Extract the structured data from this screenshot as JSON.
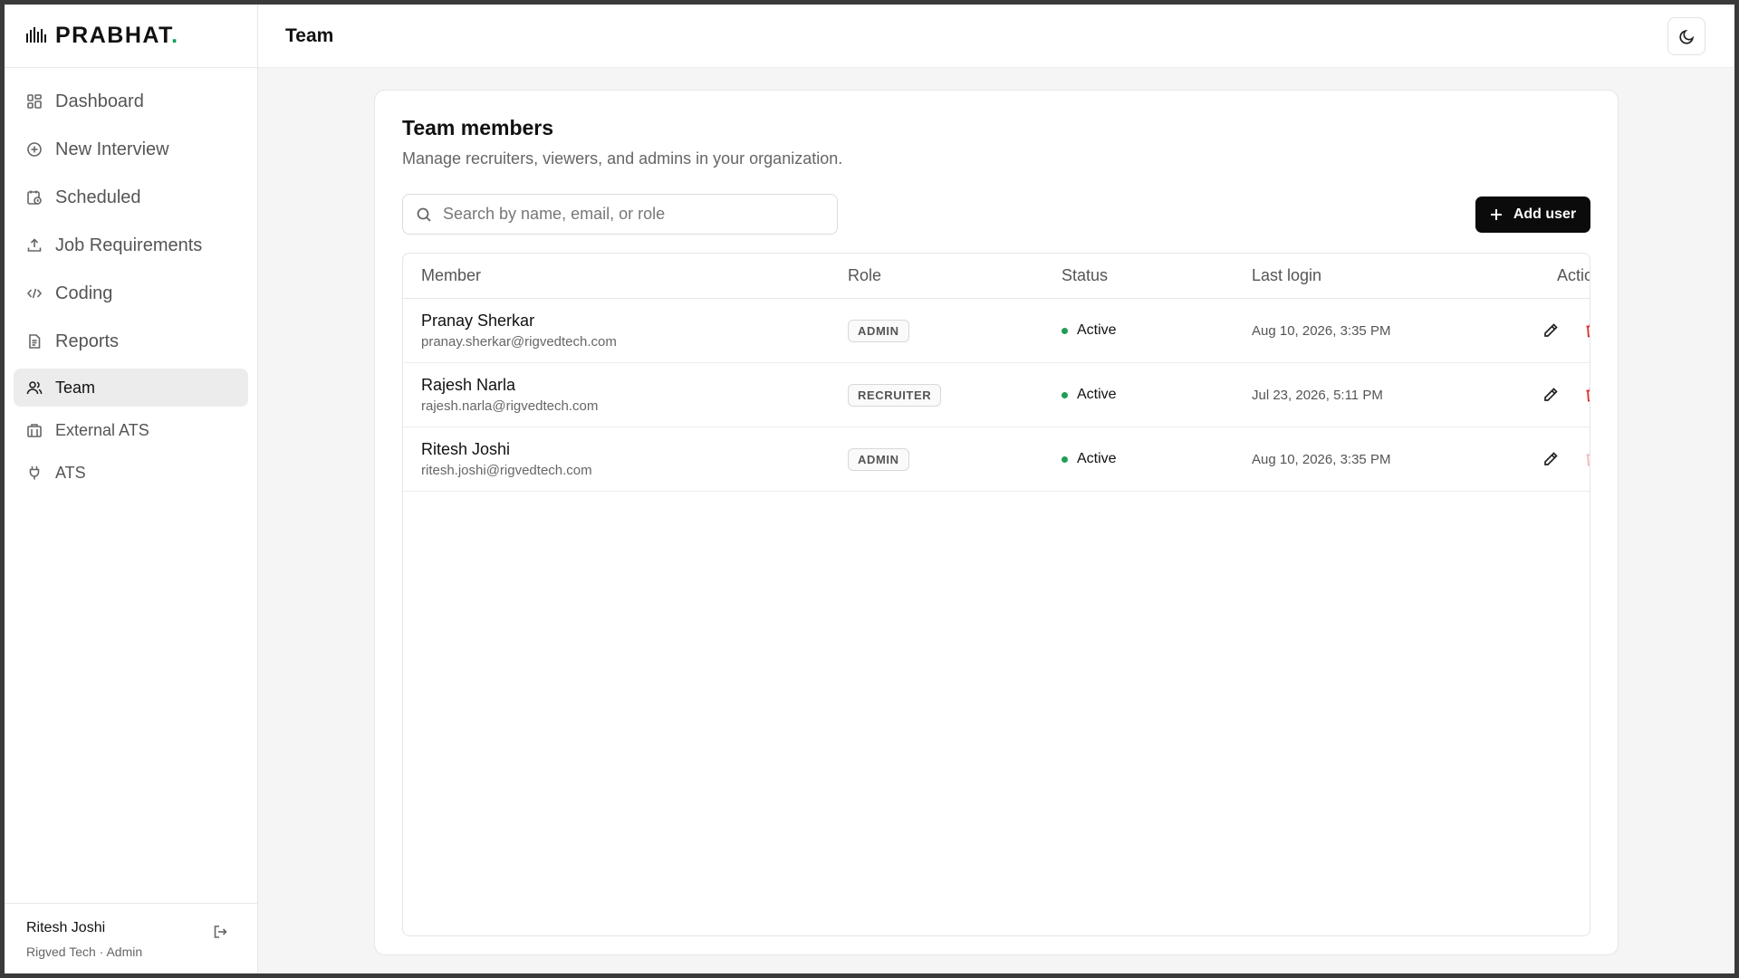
{
  "brand": {
    "name": "PRABHAT",
    "dot": ".",
    "accent": "#0f9d58"
  },
  "sidebar": {
    "items": [
      {
        "label": "Dashboard",
        "icon": "grid-icon"
      },
      {
        "label": "New Interview",
        "icon": "plus-circle-icon"
      },
      {
        "label": "Scheduled",
        "icon": "calendar-clock-icon"
      },
      {
        "label": "Job Requirements",
        "icon": "upload-icon"
      },
      {
        "label": "Coding",
        "icon": "code-icon"
      },
      {
        "label": "Reports",
        "icon": "document-icon"
      },
      {
        "label": "Team",
        "icon": "users-icon",
        "active": true
      },
      {
        "label": "External ATS",
        "icon": "building-icon"
      },
      {
        "label": "ATS",
        "icon": "plug-icon"
      }
    ],
    "user": {
      "name": "Ritesh Joshi",
      "subtitle": "Rigved Tech · Admin"
    }
  },
  "header": {
    "title": "Team"
  },
  "card": {
    "title": "Team members",
    "subtitle": "Manage recruiters, viewers, and admins in your organization."
  },
  "search": {
    "placeholder": "Search by name, email, or role",
    "value": ""
  },
  "toolbar": {
    "add_label": "Add user"
  },
  "table": {
    "columns": [
      "Member",
      "Role",
      "Status",
      "Last login",
      "Actions"
    ],
    "rows": [
      {
        "name": "Pranay Sherkar",
        "email": "pranay.sherkar@rigvedtech.com",
        "role": "ADMIN",
        "status": "Active",
        "last_login": "Aug 10, 2026, 3:35 PM",
        "delete_enabled": true
      },
      {
        "name": "Rajesh Narla",
        "email": "rajesh.narla@rigvedtech.com",
        "role": "RECRUITER",
        "status": "Active",
        "last_login": "Jul 23, 2026, 5:11 PM",
        "delete_enabled": true
      },
      {
        "name": "Ritesh Joshi",
        "email": "ritesh.joshi@rigvedtech.com",
        "role": "ADMIN",
        "status": "Active",
        "last_login": "Aug 10, 2026, 3:35 PM",
        "delete_enabled": false
      }
    ]
  },
  "colors": {
    "primary_button": "#0b0b0b",
    "status_active": "#1f9d55",
    "danger": "#dc2626"
  }
}
